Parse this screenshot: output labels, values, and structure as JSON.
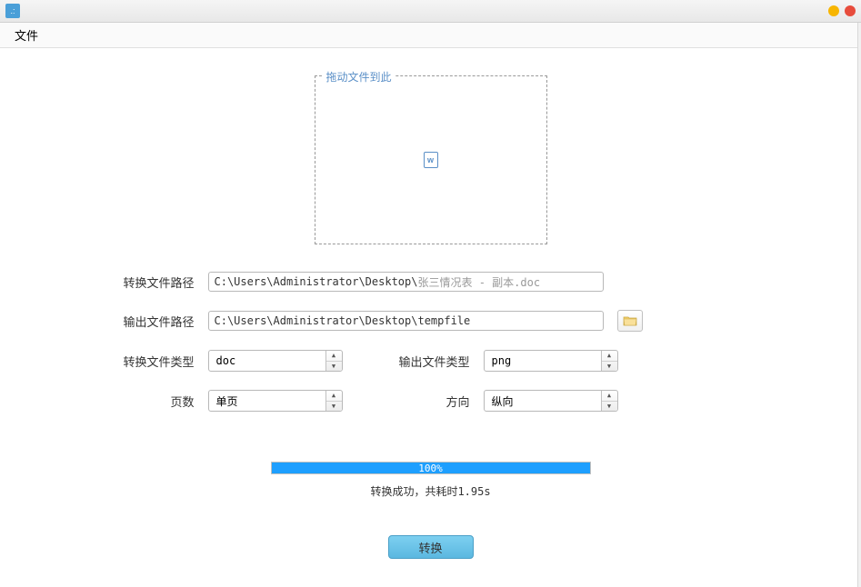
{
  "titlebar": {
    "app_icon_text": ".:"
  },
  "menubar": {
    "file": "文件"
  },
  "drop_zone": {
    "label": "拖动文件到此",
    "icon": "word-doc-icon"
  },
  "form": {
    "input_path": {
      "label": "转换文件路径",
      "value_prefix": "C:\\Users\\Administrator\\Desktop\\",
      "value_filename": "张三情况表 - 副本.doc"
    },
    "output_path": {
      "label": "输出文件路径",
      "value": "C:\\Users\\Administrator\\Desktop\\tempfile"
    },
    "input_type": {
      "label": "转换文件类型",
      "value": "doc"
    },
    "output_type": {
      "label": "输出文件类型",
      "value": "png"
    },
    "pages": {
      "label": "页数",
      "value": "单页"
    },
    "orientation": {
      "label": "方向",
      "value": "纵向"
    }
  },
  "progress": {
    "percent_text": "100%",
    "status": "转换成功，共耗时1.95s"
  },
  "buttons": {
    "convert": "转换"
  }
}
